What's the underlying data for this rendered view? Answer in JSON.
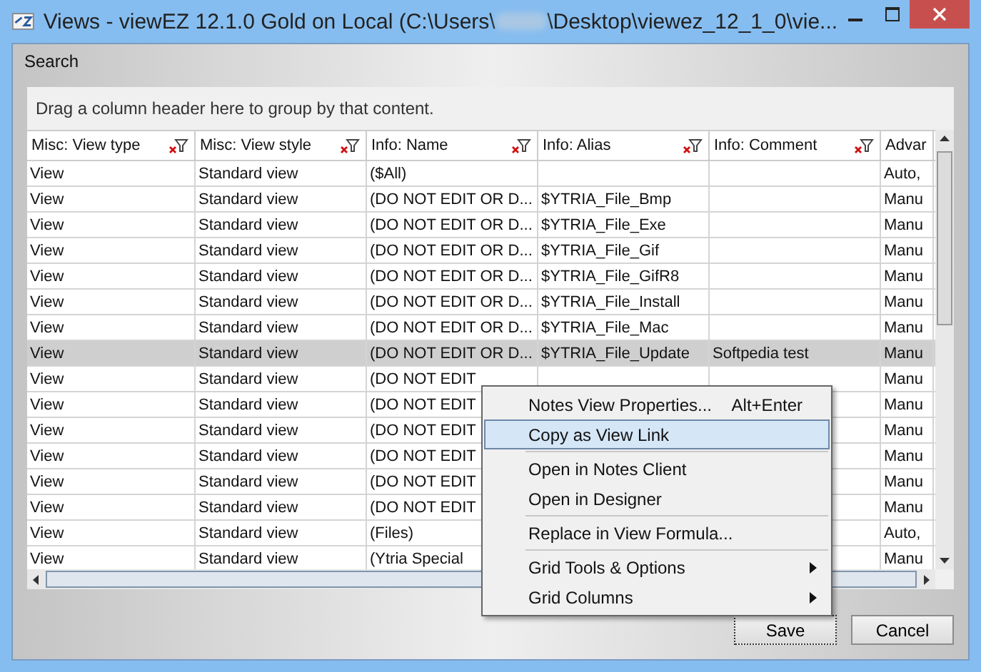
{
  "window": {
    "title_start": "Views - viewEZ 12.1.0 Gold on Local (C:\\Users\\",
    "title_end": "\\Desktop\\viewez_12_1_0\\vie..."
  },
  "menu": [
    "Search"
  ],
  "group_panel": "Drag a column header here to group by that content.",
  "table": {
    "columns": [
      {
        "label": "Misc: View type",
        "filter": true
      },
      {
        "label": "Misc: View style",
        "filter": true
      },
      {
        "label": "Info: Name",
        "filter": true
      },
      {
        "label": "Info: Alias",
        "filter": true
      },
      {
        "label": "Info: Comment",
        "filter": true
      },
      {
        "label": "Advar"
      }
    ],
    "rows": [
      {
        "selected": false,
        "cells": [
          "View",
          "Standard view",
          "($All)",
          "",
          "",
          "Auto,"
        ]
      },
      {
        "selected": false,
        "cells": [
          "View",
          "Standard view",
          "(DO NOT EDIT OR D...",
          "$YTRIA_File_Bmp",
          "",
          "Manu"
        ]
      },
      {
        "selected": false,
        "cells": [
          "View",
          "Standard view",
          "(DO NOT EDIT OR D...",
          "$YTRIA_File_Exe",
          "",
          "Manu"
        ]
      },
      {
        "selected": false,
        "cells": [
          "View",
          "Standard view",
          "(DO NOT EDIT OR D...",
          "$YTRIA_File_Gif",
          "",
          "Manu"
        ]
      },
      {
        "selected": false,
        "cells": [
          "View",
          "Standard view",
          "(DO NOT EDIT OR D...",
          "$YTRIA_File_GifR8",
          "",
          "Manu"
        ]
      },
      {
        "selected": false,
        "cells": [
          "View",
          "Standard view",
          "(DO NOT EDIT OR D...",
          "$YTRIA_File_Install",
          "",
          "Manu"
        ]
      },
      {
        "selected": false,
        "cells": [
          "View",
          "Standard view",
          "(DO NOT EDIT OR D...",
          "$YTRIA_File_Mac",
          "",
          "Manu"
        ]
      },
      {
        "selected": true,
        "cells": [
          "View",
          "Standard view",
          "(DO NOT EDIT OR D...",
          "$YTRIA_File_Update",
          "Softpedia test",
          "Manu"
        ]
      },
      {
        "selected": false,
        "cells": [
          "View",
          "Standard view",
          "(DO NOT EDIT",
          "",
          "",
          "Manu"
        ]
      },
      {
        "selected": false,
        "cells": [
          "View",
          "Standard view",
          "(DO NOT EDIT",
          "",
          "",
          "Manu"
        ]
      },
      {
        "selected": false,
        "cells": [
          "View",
          "Standard view",
          "(DO NOT EDIT",
          "",
          "",
          "Manu"
        ]
      },
      {
        "selected": false,
        "cells": [
          "View",
          "Standard view",
          "(DO NOT EDIT",
          "",
          "",
          "Manu"
        ]
      },
      {
        "selected": false,
        "cells": [
          "View",
          "Standard view",
          "(DO NOT EDIT",
          "",
          "",
          "Manu"
        ]
      },
      {
        "selected": false,
        "cells": [
          "View",
          "Standard view",
          "(DO NOT EDIT",
          "",
          "",
          "Manu"
        ]
      },
      {
        "selected": false,
        "cells": [
          "View",
          "Standard view",
          "(Files)",
          "",
          "",
          "Auto,"
        ]
      },
      {
        "selected": false,
        "cells": [
          "View",
          "Standard view",
          "(Ytria Special",
          "",
          "",
          "Manu"
        ]
      }
    ]
  },
  "buttons": [
    {
      "label": "Save",
      "default": true
    },
    {
      "label": "Cancel",
      "default": false
    }
  ],
  "context_menu": [
    {
      "label": "Notes View Properties...",
      "shortcut": "Alt+Enter",
      "selected": false,
      "separator_before": false,
      "submenu": false
    },
    {
      "label": "Copy as View Link",
      "selected": true,
      "separator_before": false,
      "submenu": false
    },
    {
      "label": "Open in Notes Client",
      "selected": false,
      "separator_before": true,
      "submenu": false
    },
    {
      "label": "Open in Designer",
      "selected": false,
      "separator_before": false,
      "submenu": false
    },
    {
      "label": "Replace in View Formula...",
      "selected": false,
      "separator_before": true,
      "submenu": false
    },
    {
      "label": "Grid Tools & Options",
      "selected": false,
      "separator_before": true,
      "submenu": true
    },
    {
      "label": "Grid Columns",
      "selected": false,
      "separator_before": false,
      "submenu": true
    }
  ]
}
